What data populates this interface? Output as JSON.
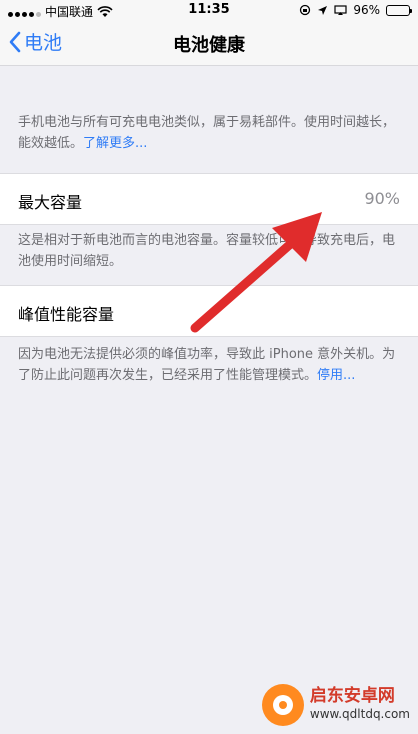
{
  "status_bar": {
    "carrier": "中国联通",
    "time": "11:35",
    "battery": "96%",
    "battery_level": 0.96
  },
  "nav": {
    "back_label": "电池",
    "title": "电池健康"
  },
  "intro": {
    "text": "手机电池与所有可充电电池类似，属于易耗部件。使用时间越长，能效越低。",
    "link": "了解更多..."
  },
  "max_capacity": {
    "label": "最大容量",
    "value": "90%",
    "description": "这是相对于新电池而言的电池容量。容量较低可能导致充电后，电池使用时间缩短。"
  },
  "peak_performance": {
    "label": "峰值性能容量",
    "description": "因为电池无法提供必须的峰值功率，导致此 iPhone 意外关机。为了防止此问题再次发生，已经采用了性能管理模式。",
    "link": "停用..."
  },
  "annotation": {
    "arrow_color": "#e02c2c"
  },
  "watermark": {
    "name": "启东安卓网",
    "url": "www.qdltdq.com"
  },
  "colors": {
    "accent": "#2f7cf6",
    "background": "#efeff4",
    "secondary_text": "#6d6d72"
  }
}
